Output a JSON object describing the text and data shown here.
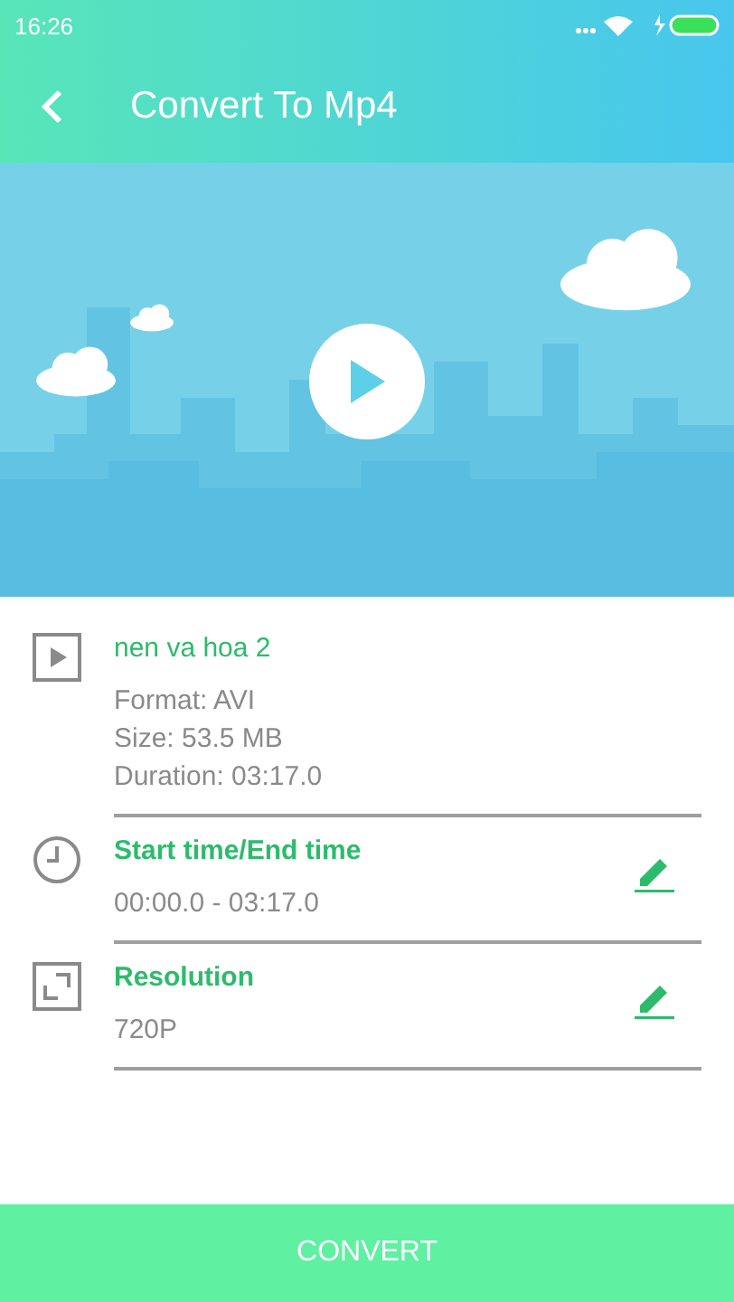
{
  "status_bar": {
    "time": "16:26"
  },
  "header": {
    "title": "Convert To Mp4"
  },
  "items": [
    {
      "kind": "file",
      "title": "nen va hoa 2",
      "details": [
        "Format: AVI",
        "Size: 53.5 MB",
        "Duration: 03:17.0"
      ]
    },
    {
      "kind": "time",
      "title": "Start time/End time",
      "details": [
        "00:00.0 - 03:17.0"
      ]
    },
    {
      "kind": "resolution",
      "title": "Resolution",
      "details": [
        "720P"
      ]
    }
  ],
  "convert_button": {
    "label": "CONVERT"
  }
}
